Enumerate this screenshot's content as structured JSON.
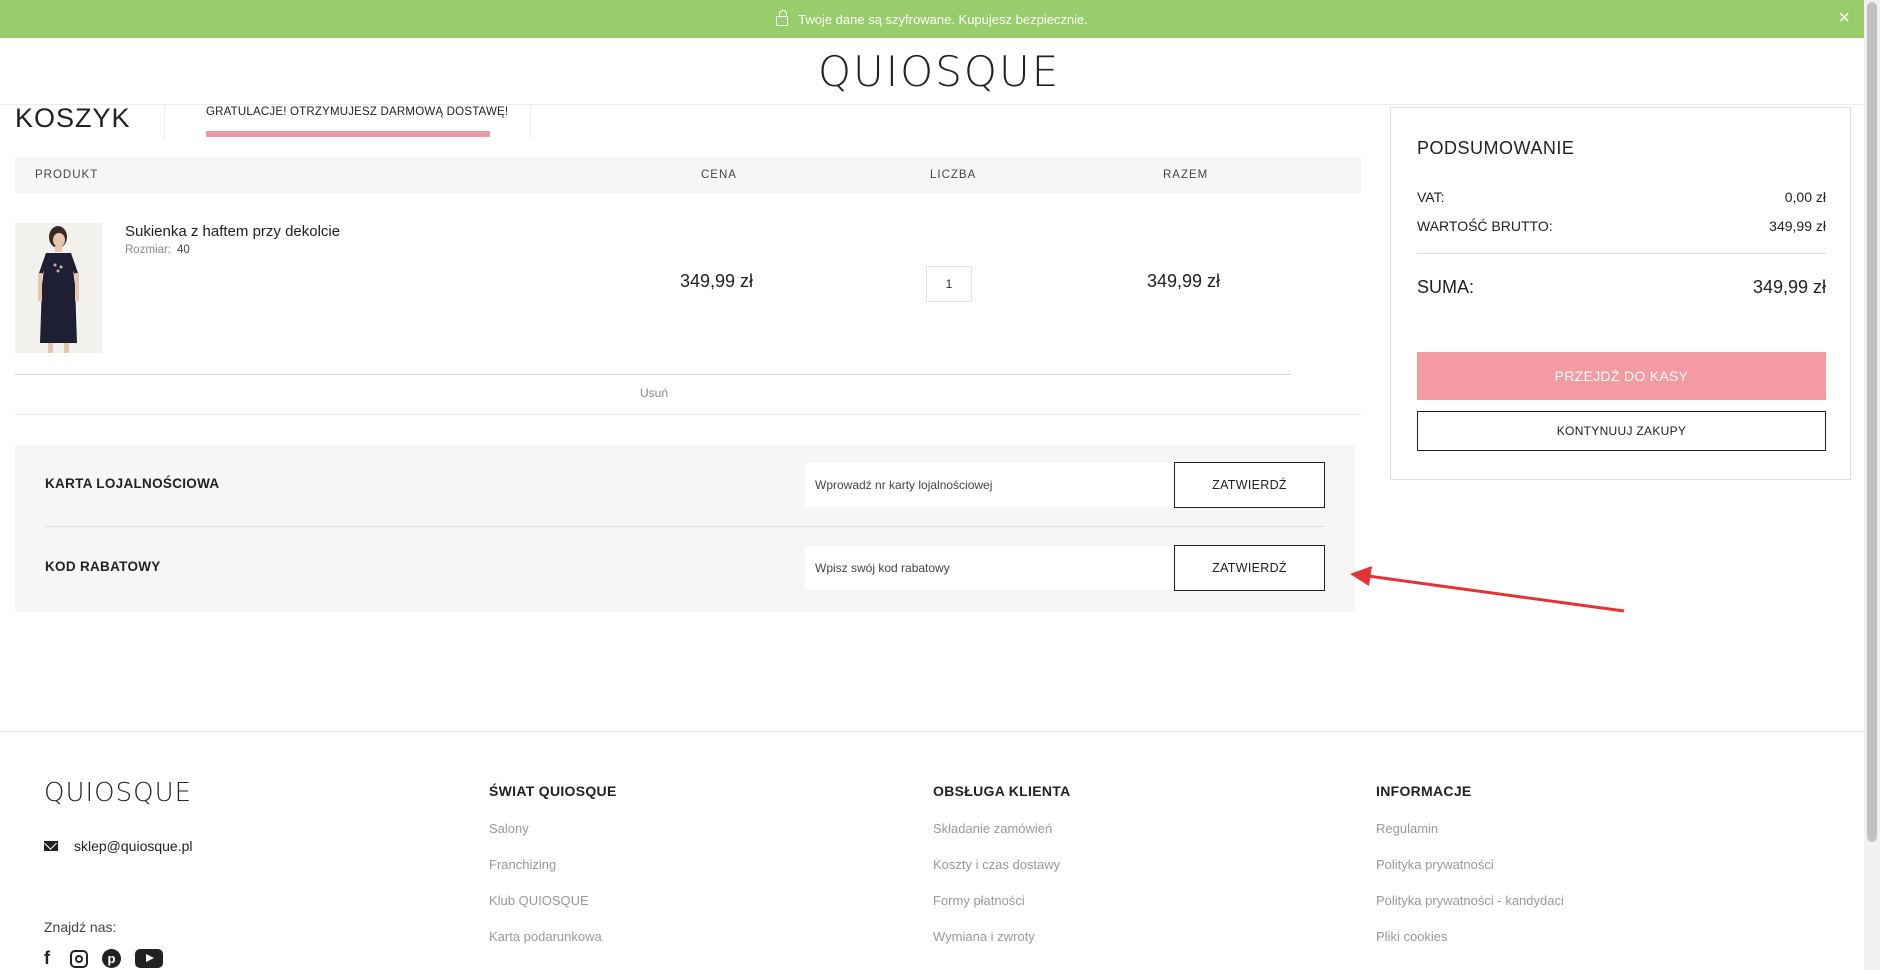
{
  "banner": {
    "text": "Twoje dane są szyfrowane. Kupujesz bezpiecznie.",
    "close_icon": "×"
  },
  "header": {
    "logo": "QUIOSQUE"
  },
  "cart": {
    "title": "KOSZYK",
    "free_shipping": "GRATULACJE! OTRZYMUJESZ DARMOWĄ DOSTAWĘ!",
    "free_shipping_progress": 1.0,
    "columns": {
      "product": "PRODUKT",
      "price": "CENA",
      "qty": "LICZBA",
      "total": "RAZEM"
    },
    "item": {
      "name": "Sukienka z haftem przy dekolcie",
      "size_label": "Rozmiar:",
      "size_value": "40",
      "price": "349,99 zł",
      "qty": "1",
      "total": "349,99 zł",
      "remove": "Usuń"
    }
  },
  "codes": {
    "loyalty_label": "KARTA LOJALNOŚCIOWA",
    "loyalty_placeholder": "Wprowadź nr karty lojalnościowej",
    "loyalty_button": "ZATWIERDŹ",
    "discount_label": "KOD RABATOWY",
    "discount_placeholder": "Wpisz swój kod rabatowy",
    "discount_button": "ZATWIERDŹ"
  },
  "summary": {
    "title": "PODSUMOWANIE",
    "vat_label": "VAT:",
    "vat_value": "0,00 zł",
    "gross_label": "WARTOŚĆ BRUTTO:",
    "gross_value": "349,99 zł",
    "sum_label": "SUMA:",
    "sum_value": "349,99 zł",
    "checkout_button": "PRZEJDŹ DO KASY",
    "continue_button": "KONTYNUUJ ZAKUPY"
  },
  "footer": {
    "logo": "QUIOSQUE",
    "email": "sklep@quiosque.pl",
    "find_us": "Znajdź nas:",
    "col1": {
      "title": "ŚWIAT QUIOSQUE",
      "links": [
        "Salony",
        "Franchizing",
        "Klub QUIOSQUE",
        "Karta podarunkowa"
      ]
    },
    "col2": {
      "title": "OBSŁUGA KLIENTA",
      "links": [
        "Składanie zamówień",
        "Koszty i czas dostawy",
        "Formy płatności",
        "Wymiana i zwroty"
      ]
    },
    "col3": {
      "title": "INFORMACJE",
      "links": [
        "Regulamin",
        "Polityka prywatności",
        "Polityka prywatności - kandydaci",
        "Pliki cookies"
      ]
    }
  },
  "colors": {
    "banner": "#97cd6a",
    "accent_pink": "#f49aa2",
    "annotation_arrow": "#e53333"
  }
}
